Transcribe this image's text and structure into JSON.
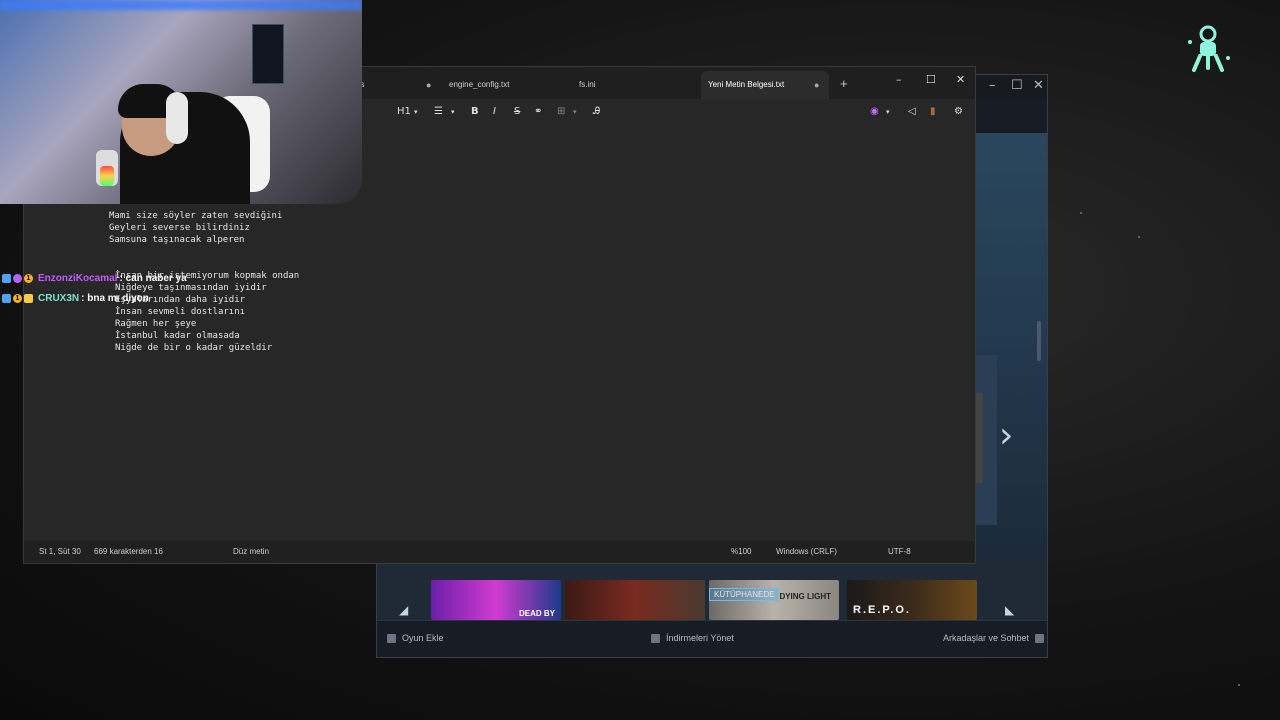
{
  "steam": {
    "bottombar": {
      "add_game": "Oyun Ekle",
      "manage_downloads": "İndirmeleri Yönet",
      "friends_chat": "Arkadaşlar ve Sohbet"
    },
    "library_badge": "KÜTÜPHANEDE",
    "tiles": [
      {
        "label": "DEAD BY"
      },
      {
        "label": ""
      },
      {
        "label": "DYING LIGHT"
      },
      {
        "label": "R.E.P.O."
      }
    ]
  },
  "notepad": {
    "tabs": [
      {
        "label": "gs"
      },
      {
        "label": "engine_config.txt"
      },
      {
        "label": "fs.ini"
      },
      {
        "label": "Yeni Metin Belgesi.txt"
      }
    ],
    "toolbar": {
      "heading": "H1"
    },
    "lines": [
      "Mami size söyler zaten sevdiğini",
      "Geyleri severse bilirdiniz",
      "Samsuna taşınacak alperen",
      "İnsan bir istemiyorum kopmak ondan",
      "Niğdeye taşınmasından iyidir",
      "Eşyalarından daha iyidir",
      "İnsan sevmeli dostlarını",
      "Rağmen her şeye",
      "İstanbul kadar olmasada",
      "Niğde de bir o kadar güzeldir"
    ],
    "status": {
      "position": "St 1, Süt 30",
      "count": "669 karakterden 16",
      "format": "Düz metin",
      "zoom": "%100",
      "line_ending": "Windows (CRLF)",
      "encoding": "UTF-8"
    }
  },
  "chat": [
    {
      "user": "EnzonziKocamal",
      "text": ": can naber ya",
      "color": "#c45bff"
    },
    {
      "user": "CRUX3N",
      "text": ": bna mı diyon",
      "color": "#7fe0c8"
    }
  ],
  "colors": {
    "accent_logo": "#8ff5dc"
  }
}
